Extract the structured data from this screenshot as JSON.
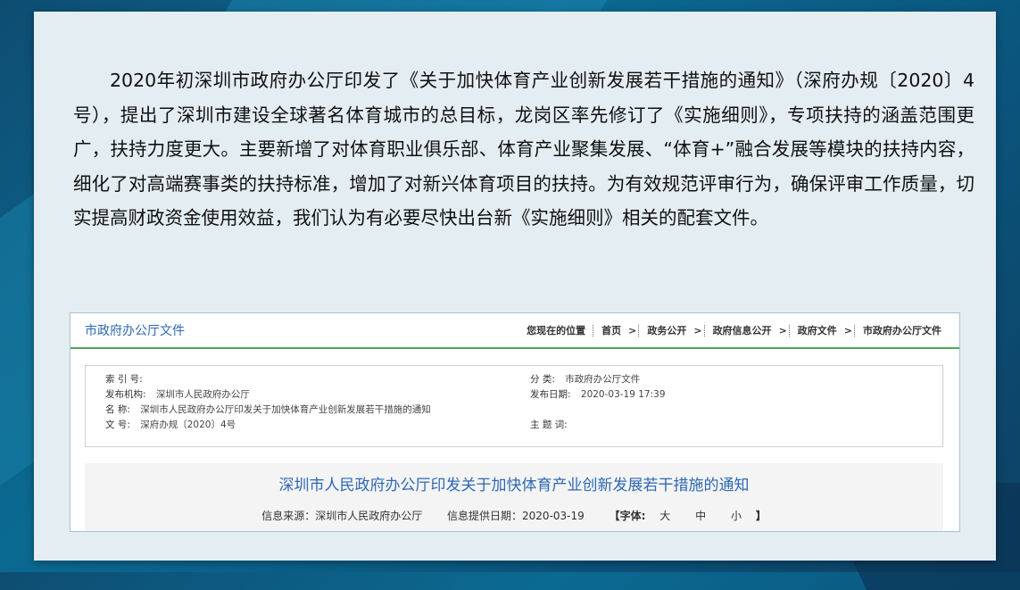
{
  "paragraph": "2020年初深圳市政府办公厅印发了《关于加快体育产业创新发展若干措施的通知》（深府办规〔2020〕4号），提出了深圳市建设全球著名体育城市的总目标，龙岗区率先修订了《实施细则》，专项扶持的涵盖范围更广，扶持力度更大。主要新增了对体育职业俱乐部、体育产业聚集发展、“体育+”融合发展等模块的扶持内容，细化了对高端赛事类的扶持标准，增加了对新兴体育项目的扶持。为有效规范评审行为，确保评审工作质量，切实提高财政资金使用效益，我们认为有必要尽快出台新《实施细则》相关的配套文件。",
  "panel": {
    "title": "市政府办公厅文件",
    "breadcrumb": {
      "prefix": "您现在的位置",
      "items": [
        "首页",
        "政务公开",
        "政府信息公开",
        "政府文件",
        "市政府办公厅文件"
      ],
      "arrow": ">"
    },
    "meta": {
      "index_label": "索 引 号:",
      "index_value": "",
      "org_label": "发布机构:",
      "org_value": "深圳市人民政府办公厅",
      "name_label": "名 称:",
      "name_value": "深圳市人民政府办公厅印发关于加快体育产业创新发展若干措施的通知",
      "docno_label": "文 号:",
      "docno_value": "深府办规〔2020〕4号",
      "category_label": "分 类:",
      "category_value": "市政府办公厅文件",
      "date_label": "发布日期:",
      "date_value": "2020-03-19 17:39",
      "keywords_label": "主 题 词:",
      "keywords_value": ""
    },
    "doc_title": "深圳市人民政府办公厅印发关于加快体育产业创新发展若干措施的通知",
    "info": {
      "source": "信息来源：深圳市人民政府办公厅",
      "provide_date": "信息提供日期：2020-03-19",
      "font_open": "【字体:",
      "font_large": "大",
      "font_medium": "中",
      "font_small": "小",
      "font_close": "】"
    }
  }
}
